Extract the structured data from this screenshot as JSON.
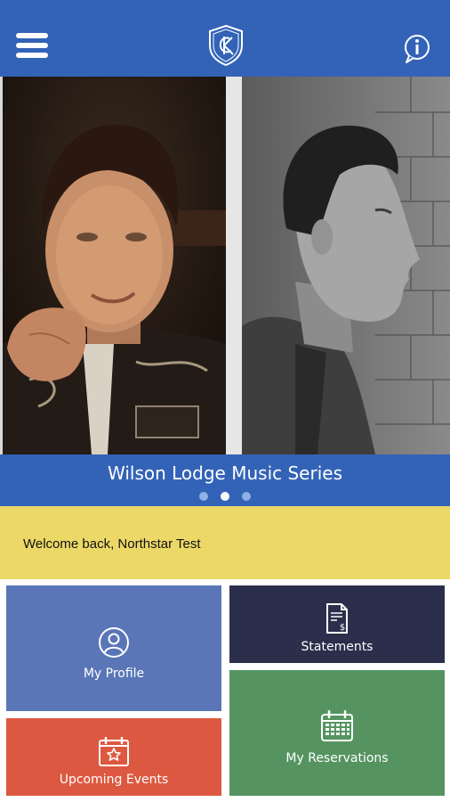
{
  "header": {
    "menu_icon": "hamburger-menu-icon",
    "logo_icon": "shield-crest-logo-icon",
    "info_icon": "info-bubble-icon",
    "color": "#3363b7"
  },
  "carousel": {
    "title": "Wilson Lodge Music Series",
    "slide_count": 3,
    "active_slide": 2
  },
  "welcome": {
    "text": "Welcome back, Northstar Test",
    "color": "#ecd867"
  },
  "tiles": {
    "profile": {
      "label": "My Profile",
      "icon": "user-circle-icon",
      "color": "#5a76b7"
    },
    "statements": {
      "label": "Statements",
      "icon": "document-dollar-icon",
      "color": "#2b2f4b"
    },
    "events": {
      "label": "Upcoming Events",
      "icon": "calendar-star-icon",
      "color": "#dd5840"
    },
    "reservations": {
      "label": "My Reservations",
      "icon": "calendar-grid-icon",
      "color": "#559461"
    }
  }
}
